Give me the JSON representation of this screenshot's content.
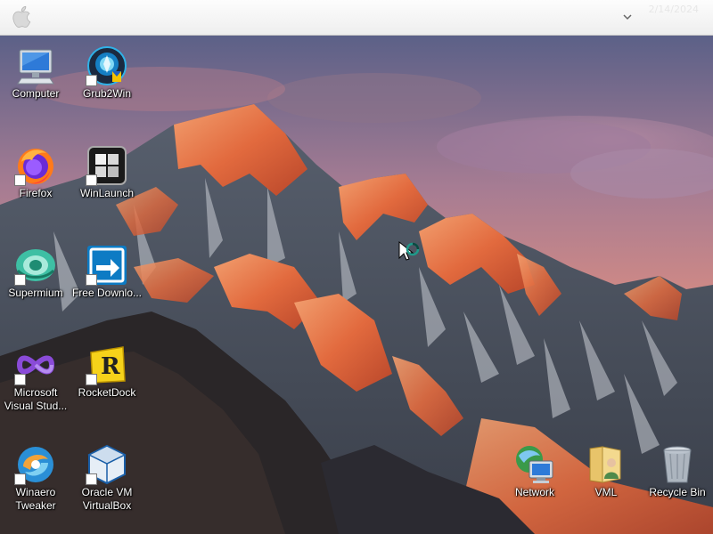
{
  "menubar": {
    "date": "2/14/2024",
    "time": ""
  },
  "desktop_icons": [
    {
      "id": "computer",
      "label": "Computer",
      "icon": "computer-monitor-icon",
      "shortcut": false
    },
    {
      "id": "grub2win",
      "label": "Grub2Win",
      "icon": "grub2win-icon",
      "shortcut": true
    },
    {
      "id": "firefox",
      "label": "Firefox",
      "icon": "firefox-icon",
      "shortcut": true
    },
    {
      "id": "winlaunch",
      "label": "WinLaunch",
      "icon": "winlaunch-icon",
      "shortcut": true
    },
    {
      "id": "supermium",
      "label": "Supermium",
      "icon": "supermium-icon",
      "shortcut": true
    },
    {
      "id": "free-download",
      "label": "Free Downlo...",
      "icon": "download-arrow-icon",
      "shortcut": true
    },
    {
      "id": "visual-studio",
      "label": "Microsoft Visual Stud...",
      "icon": "visual-studio-icon",
      "shortcut": true
    },
    {
      "id": "rocketdock",
      "label": "RocketDock",
      "icon": "rocketdock-icon",
      "shortcut": true
    },
    {
      "id": "winaero",
      "label": "Winaero Tweaker",
      "icon": "winaero-tweaker-icon",
      "shortcut": true
    },
    {
      "id": "virtualbox",
      "label": "Oracle VM VirtualBox",
      "icon": "virtualbox-icon",
      "shortcut": true
    },
    {
      "id": "network",
      "label": "Network",
      "icon": "network-globe-icon",
      "shortcut": false
    },
    {
      "id": "vml",
      "label": "VML",
      "icon": "user-folder-icon",
      "shortcut": false
    },
    {
      "id": "recycle-bin",
      "label": "Recycle Bin",
      "icon": "recycle-bin-icon",
      "shortcut": false
    }
  ],
  "colors": {
    "sky_top": "#485a86",
    "sky_mid": "#c48a8e",
    "sky_horizon": "#e49a82",
    "alpenglow": "#e5744a",
    "rock_dark": "#25252c"
  }
}
